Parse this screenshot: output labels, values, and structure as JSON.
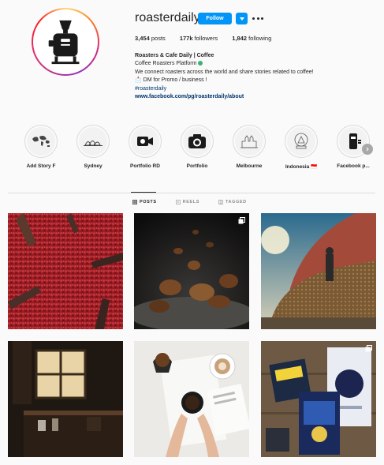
{
  "profile": {
    "username": "roasterdaily",
    "follow_label": "Follow",
    "stats": {
      "posts": "3,454",
      "posts_label": "posts",
      "followers": "177k",
      "followers_label": "followers",
      "following": "1,842",
      "following_label": "following"
    },
    "bio": {
      "name": "Roasters & Cafe Daily | Coffee",
      "category": "Coffee Roasters Platform",
      "line1": "We connect roasters across the world and share stories related to coffee!",
      "line2": "📩 DM for Promo / business !",
      "hashtag": "#roasterdaily",
      "link": "www.facebook.com/pg/roasterdaily/about"
    }
  },
  "highlights": [
    {
      "label": "Add Story F",
      "icon": "world-map-icon"
    },
    {
      "label": "Sydney",
      "icon": "opera-house-icon"
    },
    {
      "label": "Portfolio RD",
      "icon": "video-camera-icon"
    },
    {
      "label": "Portfolio",
      "icon": "camera-icon"
    },
    {
      "label": "Melbourne",
      "icon": "building-icon"
    },
    {
      "label": "Indonesia 🇮🇩",
      "icon": "snow-globe-icon"
    },
    {
      "label": "Facebook p...",
      "icon": "coffee-machine-icon"
    }
  ],
  "tabs": [
    {
      "label": "POSTS",
      "icon": "grid-icon",
      "active": true
    },
    {
      "label": "REELS",
      "icon": "reels-icon",
      "active": false
    },
    {
      "label": "TAGGED",
      "icon": "tag-icon",
      "active": false
    }
  ],
  "posts": [
    {
      "subject": "red-coffee-cherries",
      "multi": false
    },
    {
      "subject": "falling-coffee-beans",
      "multi": true
    },
    {
      "subject": "drying-beans-farm",
      "multi": false
    },
    {
      "subject": "cafe-window-interior",
      "multi": false
    },
    {
      "subject": "latte-and-newspaper",
      "multi": false
    },
    {
      "subject": "coffee-bags-flatlay",
      "multi": true
    }
  ],
  "colors": {
    "accent": "#0095f6",
    "link": "#00376b",
    "text": "#262626",
    "muted": "#8e8e8e",
    "border": "#dbdbdb"
  }
}
